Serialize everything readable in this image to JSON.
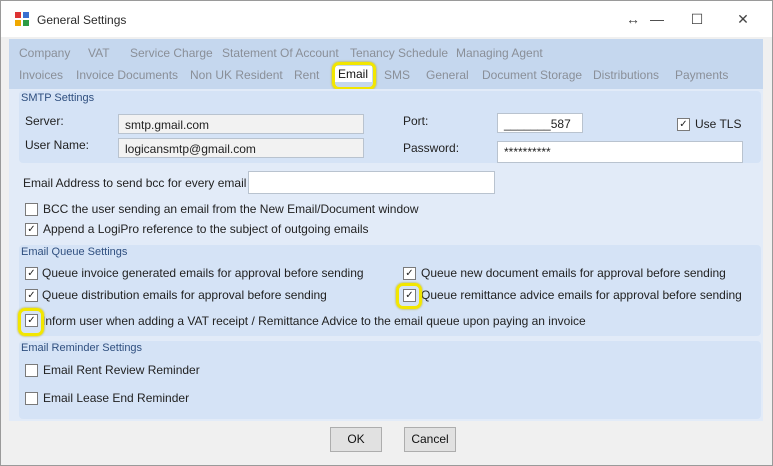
{
  "window": {
    "title": "General Settings",
    "controls": {
      "resize": "↔",
      "minimize": "—",
      "maximize": "☐",
      "close": "✕"
    }
  },
  "tabs": {
    "row1": [
      "Company",
      "VAT",
      "Service Charge",
      "Statement Of Account",
      "Tenancy Schedule",
      "Managing Agent"
    ],
    "row2": [
      "Invoices",
      "Invoice Documents",
      "Non UK Resident",
      "Rent",
      "Email",
      "SMS",
      "General",
      "Document Storage",
      "Distributions",
      "Payments"
    ],
    "active": "Email"
  },
  "smtp": {
    "section_title": "SMTP Settings",
    "server_label": "Server:",
    "server_value": "smtp.gmail.com",
    "username_label": "User Name:",
    "username_value": "logicansmtp@gmail.com",
    "port_label": "Port:",
    "port_value": "_______587",
    "password_label": "Password:",
    "password_value": "**********",
    "use_tls_label": "Use TLS",
    "use_tls_checked": true
  },
  "bcc": {
    "address_label": "Email Address to send bcc for every email sent:",
    "address_value": "",
    "bcc_user_label": "BCC the user sending an email from the New Email/Document window",
    "bcc_user_checked": false,
    "append_ref_label": "Append a LogiPro reference to the subject of outgoing emails",
    "append_ref_checked": true
  },
  "queue": {
    "section_title": "Email Queue Settings",
    "invoice_label": "Queue invoice generated emails for approval before sending",
    "new_doc_label": "Queue new document emails for approval before sending",
    "distribution_label": "Queue distribution emails for approval before sending",
    "remittance_label": "Queue remittance advice emails for approval before sending",
    "inform_label": "Inform user when adding a VAT receipt / Remittance Advice to the email queue upon paying an invoice",
    "check_mark": "✓"
  },
  "reminder": {
    "section_title": "Email Reminder Settings",
    "rent_review_label": "Email Rent Review Reminder",
    "lease_end_label": "Email Lease End Reminder"
  },
  "buttons": {
    "ok": "OK",
    "cancel": "Cancel"
  }
}
